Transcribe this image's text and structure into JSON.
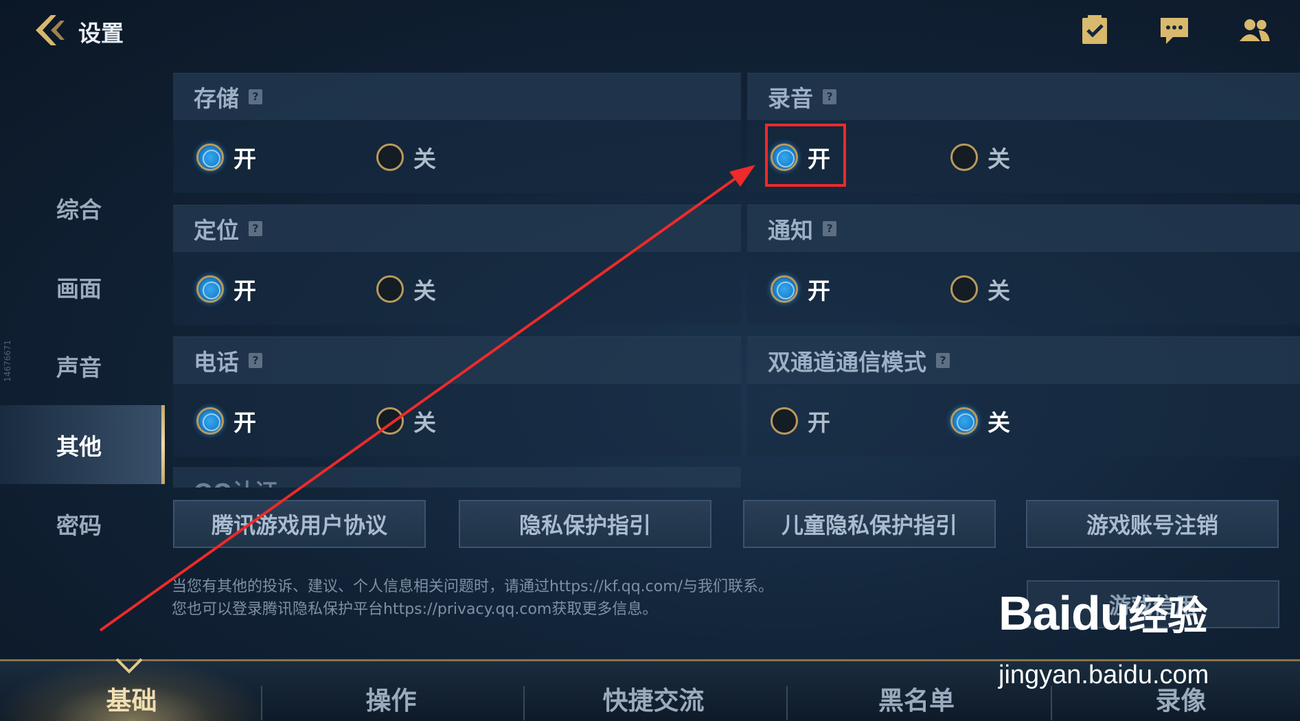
{
  "header": {
    "title": "设置"
  },
  "sidebar": {
    "items": [
      {
        "label": "综合",
        "active": false
      },
      {
        "label": "画面",
        "active": false
      },
      {
        "label": "声音",
        "active": false
      },
      {
        "label": "其他",
        "active": true
      },
      {
        "label": "密码",
        "active": false
      }
    ],
    "side_id": "14676671"
  },
  "settings": {
    "storage": {
      "title": "存储",
      "on_label": "开",
      "off_label": "关",
      "selected": "on"
    },
    "recording": {
      "title": "录音",
      "on_label": "开",
      "off_label": "关",
      "selected": "on"
    },
    "location": {
      "title": "定位",
      "on_label": "开",
      "off_label": "关",
      "selected": "on"
    },
    "notification": {
      "title": "通知",
      "on_label": "开",
      "off_label": "关",
      "selected": "on"
    },
    "phone": {
      "title": "电话",
      "on_label": "开",
      "off_label": "关",
      "selected": "on"
    },
    "dual_channel": {
      "title": "双通道通信模式",
      "on_label": "开",
      "off_label": "关",
      "selected": "off"
    },
    "partial_title": "QQ认证"
  },
  "buttons": {
    "user_agreement": "腾讯游戏用户协议",
    "privacy_guide": "隐私保护指引",
    "child_privacy": "儿童隐私保护指引",
    "account_cancel": "游戏账号注销",
    "game_credit": "游戏信用"
  },
  "notice": {
    "line1": "当您有其他的投诉、建议、个人信息相关问题时，请通过https://kf.qq.com/与我们联系。",
    "line2": "您也可以登录腾讯隐私保护平台https://privacy.qq.com获取更多信息。"
  },
  "bottom_tabs": [
    {
      "label": "基础",
      "active": true
    },
    {
      "label": "操作",
      "active": false
    },
    {
      "label": "快捷交流",
      "active": false
    },
    {
      "label": "黑名单",
      "active": false
    },
    {
      "label": "录像",
      "active": false
    }
  ],
  "watermark": {
    "logo": "Bai",
    "logo_du": "du",
    "logo_cn": "经验",
    "url": "jingyan.baidu.com"
  },
  "colors": {
    "accent_gold": "#c7a96a",
    "radio_on": "#2a96e0",
    "annotation_red": "#ee2a2a"
  },
  "icons": [
    "back-chevron-icon",
    "checklist-icon",
    "chat-icon",
    "friends-icon",
    "help-icon"
  ]
}
